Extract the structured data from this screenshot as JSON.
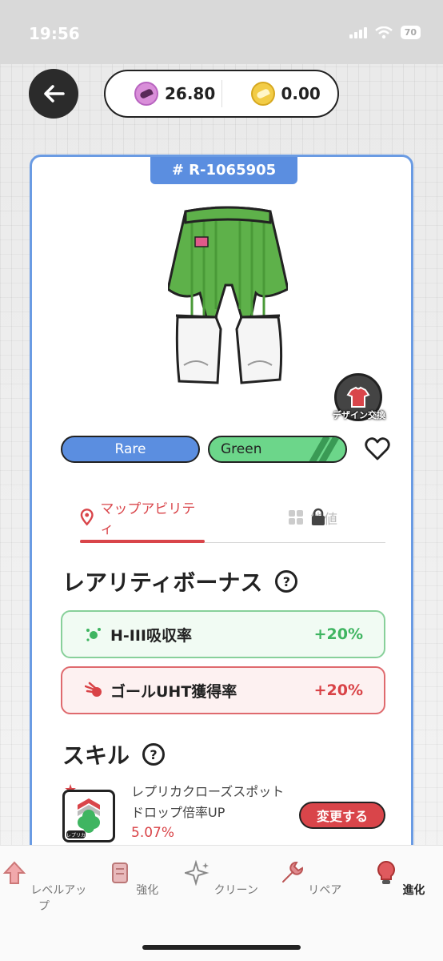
{
  "status": {
    "time": "19:56",
    "battery": "70"
  },
  "currency": {
    "primary_value": "26.80",
    "secondary_value": "0.00"
  },
  "item": {
    "id": "# R-1065905",
    "design_exchange_label": "デザイン交換",
    "rarity": "Rare",
    "color_type": "Green"
  },
  "tabs": {
    "map_ability": "マップアビリティ",
    "stats": "能値"
  },
  "rarity_bonus": {
    "title": "レアリティボーナス",
    "items": [
      {
        "label": "H-III吸収率",
        "value": "+20%"
      },
      {
        "label": "ゴールUHT獲得率",
        "value": "+20%"
      }
    ]
  },
  "skill": {
    "title": "スキル",
    "name": "レプリカクローズスポットドロップ倍率UP",
    "rate": "5.07%",
    "change_button": "変更する",
    "icon_badge": "レプリカ"
  },
  "bottom_nav": [
    {
      "label": "レベルアップ",
      "icon": "level-up-arrow-icon"
    },
    {
      "label": "強化",
      "icon": "scroll-icon"
    },
    {
      "label": "クリーン",
      "icon": "sparkle-icon"
    },
    {
      "label": "リペア",
      "icon": "wrench-icon"
    },
    {
      "label": "進化",
      "icon": "lightbulb-icon"
    }
  ],
  "colors": {
    "accent_red": "#d9454a",
    "rare_blue": "#5b8ee0",
    "green_tag": "#6cd68a",
    "bonus_green": "#3fb561"
  }
}
